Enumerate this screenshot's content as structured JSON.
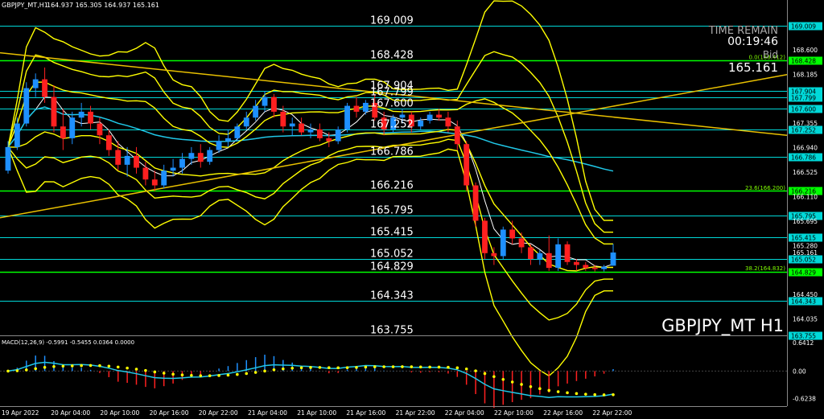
{
  "window": {
    "title": "GBPJPY_MT,H1",
    "ohlc": "164.937 165.305 164.937 165.161",
    "symbol_label": "GBPJPY_MT H1",
    "time_remain_label": "TIME REMAIN",
    "time_remain": "00:19:46",
    "bid_label": "Bid",
    "bid": "165.161"
  },
  "colors": {
    "background": "#000000",
    "bull": "#1e90ff",
    "bear": "#ff2020",
    "hline": "#00d8d8",
    "green_level": "#00ff00",
    "bands": "#ffff00",
    "ma_cyan": "#20c8e8",
    "ma_white": "#ffffff",
    "trend": "#e8c000"
  },
  "levels": [
    {
      "value": "169.009",
      "label": "169.009"
    },
    {
      "value": "168.428",
      "label": "168.428"
    },
    {
      "value": "167.904",
      "label": "167.904"
    },
    {
      "value": "167.799",
      "label": "167.799"
    },
    {
      "value": "167.600",
      "label": "167.600"
    },
    {
      "value": "167.252",
      "label": "167.252"
    },
    {
      "value": "166.786",
      "label": "166.786"
    },
    {
      "value": "166.216",
      "label": "166.216"
    },
    {
      "value": "165.795",
      "label": "165.795"
    },
    {
      "value": "165.415",
      "label": "165.415"
    },
    {
      "value": "165.052",
      "label": "165.052"
    },
    {
      "value": "164.829",
      "label": "164.829"
    },
    {
      "value": "164.343",
      "label": "164.343"
    },
    {
      "value": "163.755",
      "label": "163.755"
    }
  ],
  "fib_labels": [
    "0.0(168.412)",
    "23.6(166.200)",
    "38.2(164.832)"
  ],
  "chart_data": {
    "type": "candlestick",
    "timeframe": "H1",
    "ylim": [
      163.9,
      169.35
    ],
    "price_axis_ticks": [
      "169.009",
      "168.600",
      "168.428",
      "168.185",
      "167.904",
      "167.799",
      "167.600",
      "167.355",
      "167.252",
      "166.940",
      "166.786",
      "166.525",
      "166.216",
      "166.110",
      "165.795",
      "165.695",
      "165.415",
      "165.280",
      "165.161",
      "165.052",
      "164.829",
      "164.450",
      "164.343",
      "164.035"
    ],
    "x_ticks": [
      "19 Apr 2022",
      "20 Apr 04:00",
      "20 Apr 10:00",
      "20 Apr 16:00",
      "20 Apr 22:00",
      "21 Apr 04:00",
      "21 Apr 10:00",
      "21 Apr 16:00",
      "21 Apr 22:00",
      "22 Apr 04:00",
      "22 Apr 10:00",
      "22 Apr 16:00",
      "22 Apr 22:00"
    ],
    "candles": [
      [
        166.55,
        167.05,
        166.5,
        166.95
      ],
      [
        166.95,
        167.45,
        166.9,
        167.35
      ],
      [
        167.35,
        168.05,
        167.3,
        167.95
      ],
      [
        167.95,
        168.2,
        167.8,
        168.1
      ],
      [
        168.1,
        168.3,
        167.7,
        167.8
      ],
      [
        167.8,
        168.0,
        167.2,
        167.3
      ],
      [
        167.3,
        167.6,
        166.9,
        167.1
      ],
      [
        167.1,
        167.55,
        167.0,
        167.45
      ],
      [
        167.45,
        167.7,
        167.3,
        167.55
      ],
      [
        167.55,
        167.65,
        167.25,
        167.35
      ],
      [
        167.35,
        167.45,
        167.0,
        167.15
      ],
      [
        167.15,
        167.25,
        166.8,
        166.9
      ],
      [
        166.9,
        167.05,
        166.55,
        166.65
      ],
      [
        166.65,
        166.95,
        166.45,
        166.8
      ],
      [
        166.8,
        166.95,
        166.5,
        166.6
      ],
      [
        166.6,
        166.7,
        166.3,
        166.4
      ],
      [
        166.4,
        166.55,
        166.2,
        166.3
      ],
      [
        166.3,
        166.65,
        166.25,
        166.55
      ],
      [
        166.55,
        166.75,
        166.45,
        166.6
      ],
      [
        166.6,
        166.85,
        166.5,
        166.75
      ],
      [
        166.75,
        166.95,
        166.65,
        166.85
      ],
      [
        166.85,
        167.0,
        166.6,
        166.7
      ],
      [
        166.7,
        166.95,
        166.65,
        166.9
      ],
      [
        166.9,
        167.15,
        166.85,
        167.05
      ],
      [
        167.05,
        167.25,
        166.95,
        167.1
      ],
      [
        167.1,
        167.35,
        167.05,
        167.3
      ],
      [
        167.3,
        167.55,
        167.25,
        167.45
      ],
      [
        167.45,
        167.75,
        167.4,
        167.65
      ],
      [
        167.65,
        167.9,
        167.55,
        167.8
      ],
      [
        167.8,
        167.85,
        167.45,
        167.55
      ],
      [
        167.55,
        167.65,
        167.2,
        167.3
      ],
      [
        167.3,
        167.45,
        167.15,
        167.35
      ],
      [
        167.35,
        167.45,
        167.15,
        167.2
      ],
      [
        167.2,
        167.35,
        167.1,
        167.25
      ],
      [
        167.25,
        167.35,
        167.05,
        167.1
      ],
      [
        167.1,
        167.2,
        166.95,
        167.05
      ],
      [
        167.05,
        167.3,
        167.0,
        167.25
      ],
      [
        167.25,
        167.7,
        167.2,
        167.65
      ],
      [
        167.65,
        167.8,
        167.45,
        167.55
      ],
      [
        167.55,
        167.75,
        167.5,
        167.7
      ],
      [
        167.7,
        167.85,
        167.4,
        167.45
      ],
      [
        167.45,
        167.55,
        167.15,
        167.25
      ],
      [
        167.25,
        167.5,
        167.2,
        167.45
      ],
      [
        167.45,
        167.6,
        167.35,
        167.5
      ],
      [
        167.5,
        167.55,
        167.2,
        167.3
      ],
      [
        167.3,
        167.45,
        167.25,
        167.4
      ],
      [
        167.4,
        167.55,
        167.35,
        167.5
      ],
      [
        167.5,
        167.6,
        167.4,
        167.45
      ],
      [
        167.45,
        167.55,
        167.2,
        167.3
      ],
      [
        167.3,
        167.4,
        166.9,
        167.0
      ],
      [
        167.0,
        167.05,
        166.2,
        166.3
      ],
      [
        166.3,
        166.35,
        165.6,
        165.7
      ],
      [
        165.7,
        165.75,
        165.05,
        165.15
      ],
      [
        165.15,
        165.25,
        164.95,
        165.1
      ],
      [
        165.1,
        165.6,
        165.05,
        165.55
      ],
      [
        165.55,
        165.7,
        165.3,
        165.4
      ],
      [
        165.4,
        165.5,
        165.15,
        165.25
      ],
      [
        165.25,
        165.3,
        164.95,
        165.05
      ],
      [
        165.05,
        165.2,
        164.95,
        165.15
      ],
      [
        165.15,
        165.45,
        164.85,
        164.9
      ],
      [
        164.9,
        165.4,
        164.85,
        165.3
      ],
      [
        165.3,
        165.35,
        164.95,
        165.0
      ],
      [
        165.0,
        165.05,
        164.85,
        164.95
      ],
      [
        164.95,
        165.0,
        164.85,
        164.9
      ],
      [
        164.9,
        164.95,
        164.84,
        164.88
      ],
      [
        164.88,
        164.95,
        164.84,
        164.92
      ],
      [
        164.937,
        165.305,
        164.937,
        165.161
      ]
    ],
    "macd_label": "MACD(12,26,9) -0.5991 -0.5455 0.0364 0.0000",
    "macd_ylim": [
      -0.72,
      0.68
    ],
    "macd_axis_ticks": [
      "0.6412",
      "0.00",
      "-0.6238"
    ]
  }
}
